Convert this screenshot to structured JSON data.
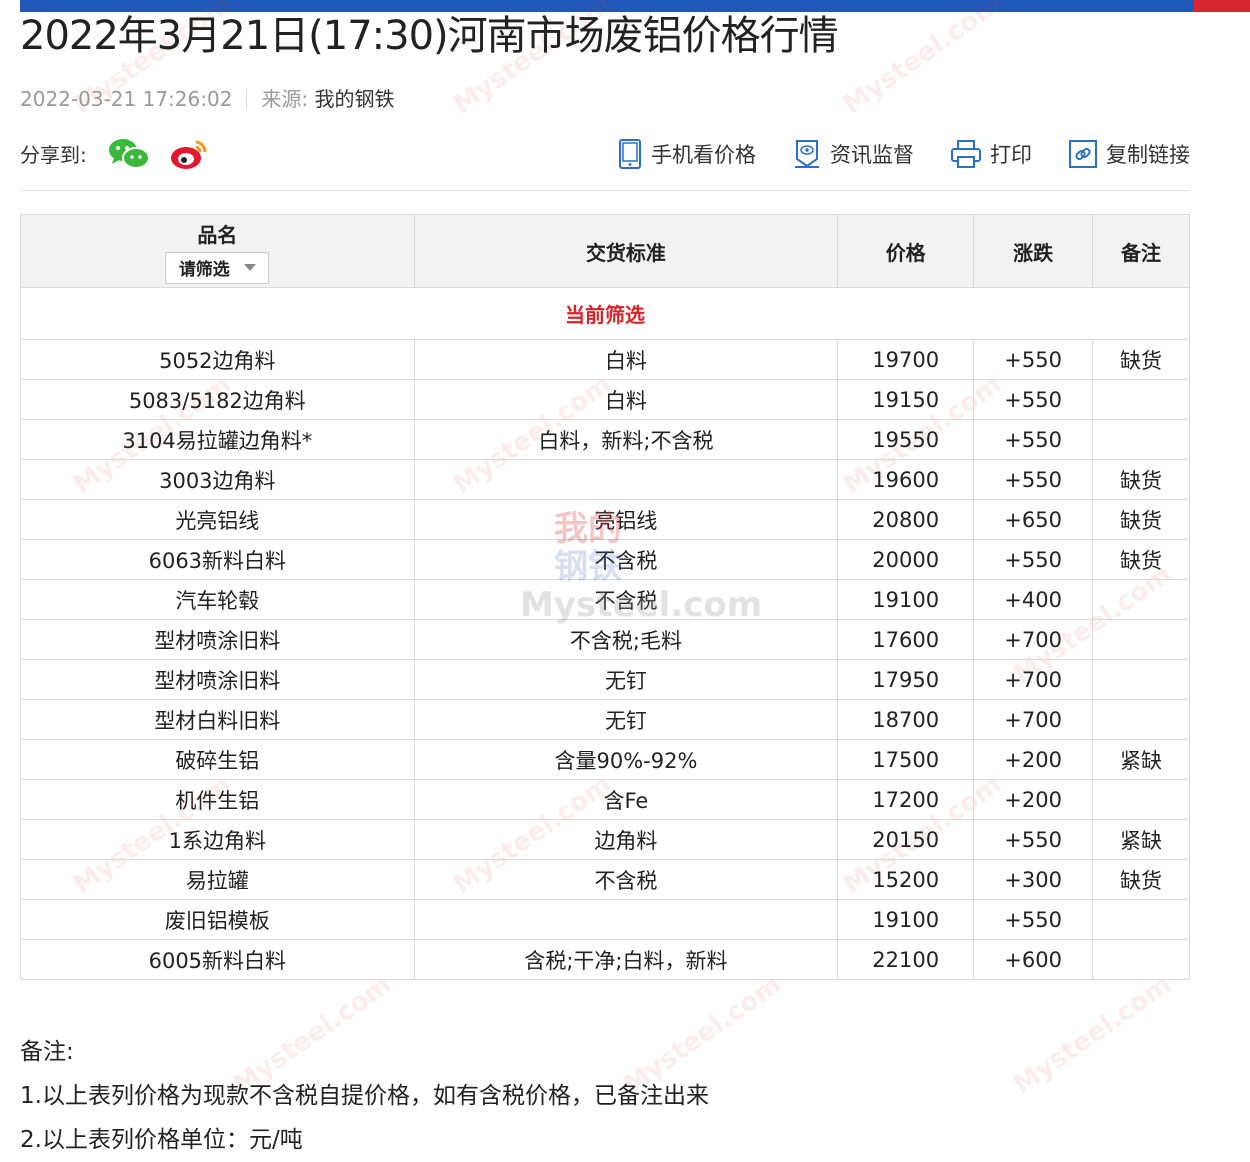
{
  "article": {
    "title": "2022年3月21日(17:30)河南市场废铝价格行情",
    "datetime": "2022-03-21 17:26:02",
    "source_label": "来源:",
    "source_value": "我的钢铁"
  },
  "share": {
    "label": "分享到:",
    "icons": [
      "wechat-icon",
      "weibo-icon"
    ]
  },
  "tools": [
    {
      "label": "手机看价格",
      "icon": "mobile-icon"
    },
    {
      "label": "资讯监督",
      "icon": "monitor-icon"
    },
    {
      "label": "打印",
      "icon": "printer-icon"
    },
    {
      "label": "复制链接",
      "icon": "link-icon"
    }
  ],
  "table": {
    "headers": {
      "name": "品名",
      "standard": "交货标准",
      "price": "价格",
      "change": "涨跌",
      "remark": "备注"
    },
    "filter_select": "请筛选",
    "current_filter_label": "当前筛选",
    "rows": [
      {
        "name": "5052边角料",
        "standard": "白料",
        "price": "19700",
        "change": "+550",
        "remark": "缺货"
      },
      {
        "name": "5083/5182边角料",
        "standard": "白料",
        "price": "19150",
        "change": "+550",
        "remark": ""
      },
      {
        "name": "3104易拉罐边角料*",
        "standard": "白料，新料;不含税",
        "price": "19550",
        "change": "+550",
        "remark": ""
      },
      {
        "name": "3003边角料",
        "standard": "",
        "price": "19600",
        "change": "+550",
        "remark": "缺货"
      },
      {
        "name": "光亮铝线",
        "standard": "亮铝线",
        "price": "20800",
        "change": "+650",
        "remark": "缺货"
      },
      {
        "name": "6063新料白料",
        "standard": "不含税",
        "price": "20000",
        "change": "+550",
        "remark": "缺货"
      },
      {
        "name": "汽车轮毂",
        "standard": "不含税",
        "price": "19100",
        "change": "+400",
        "remark": ""
      },
      {
        "name": "型材喷涂旧料",
        "standard": "不含税;毛料",
        "price": "17600",
        "change": "+700",
        "remark": ""
      },
      {
        "name": "型材喷涂旧料",
        "standard": "无钉",
        "price": "17950",
        "change": "+700",
        "remark": ""
      },
      {
        "name": "型材白料旧料",
        "standard": "无钉",
        "price": "18700",
        "change": "+700",
        "remark": ""
      },
      {
        "name": "破碎生铝",
        "standard": "含量90%-92%",
        "price": "17500",
        "change": "+200",
        "remark": "紧缺"
      },
      {
        "name": "机件生铝",
        "standard": "含Fe",
        "price": "17200",
        "change": "+200",
        "remark": ""
      },
      {
        "name": "1系边角料",
        "standard": "边角料",
        "price": "20150",
        "change": "+550",
        "remark": "紧缺"
      },
      {
        "name": "易拉罐",
        "standard": "不含税",
        "price": "15200",
        "change": "+300",
        "remark": "缺货"
      },
      {
        "name": "废旧铝模板",
        "standard": "",
        "price": "19100",
        "change": "+550",
        "remark": ""
      },
      {
        "name": "6005新料白料",
        "standard": "含税;干净;白料，新料",
        "price": "22100",
        "change": "+600",
        "remark": ""
      }
    ]
  },
  "notes": {
    "heading": "备注:",
    "items": [
      "1.以上表列价格为现款不含税自提价格，如有含税价格，已备注出来",
      "2.以上表列价格单位：元/吨"
    ]
  },
  "watermark": {
    "cn_line1": "我的",
    "cn_line2": "钢铁",
    "en": "Mysteel.com"
  },
  "colors": {
    "top_bar_blue": "#1f58b8",
    "top_bar_red": "#d8262d",
    "filter_label": "#d5232a",
    "wechat_green": "#3bb83a",
    "weibo_red": "#e6162d",
    "tool_icon_blue": "#2a6fc9"
  }
}
